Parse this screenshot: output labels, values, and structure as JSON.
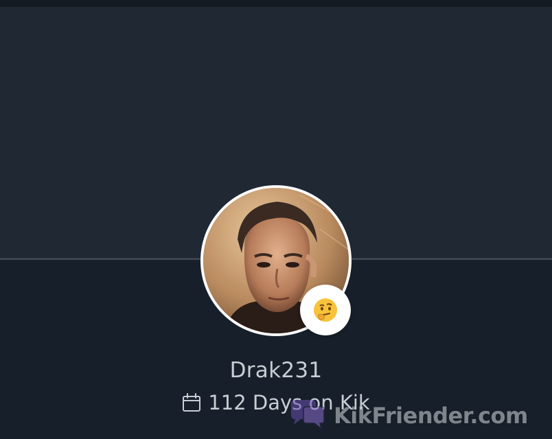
{
  "profile": {
    "username": "Drak231",
    "days_text": "112 Days on Kik",
    "status_emoji": "🤔"
  },
  "watermark": {
    "text": "KikFriender.com"
  },
  "icons": {
    "calendar": "calendar-icon",
    "watermark_logo": "chat-bubbles-icon"
  },
  "colors": {
    "background": "#17202a",
    "cover": "#1f2833",
    "text": "#c9ced4",
    "watermark_logo": "#6a4fb0"
  }
}
